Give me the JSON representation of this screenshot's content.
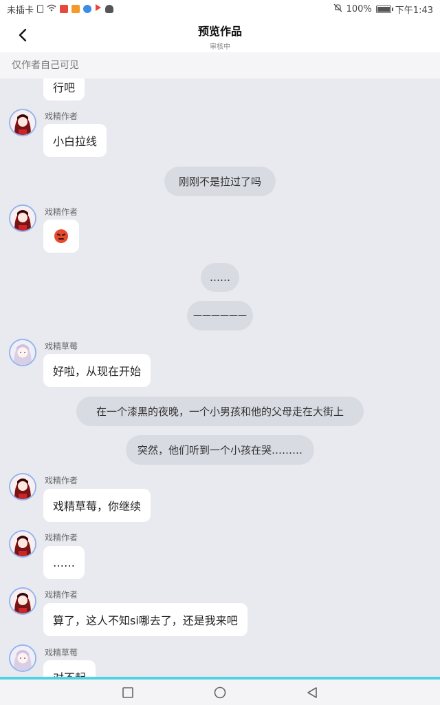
{
  "status": {
    "carrier": "未插卡",
    "battery": "100%",
    "time": "下午1:43"
  },
  "header": {
    "title": "预览作品",
    "subtitle": "审核中"
  },
  "notice": "仅作者自己可见",
  "messages": [
    {
      "type": "bubble",
      "text": "行吧"
    },
    {
      "type": "bubble",
      "sender": "戏精作者",
      "text": "小白拉线"
    },
    {
      "type": "narration",
      "text": "刚刚不是拉过了吗"
    },
    {
      "type": "bubble",
      "sender": "戏精作者",
      "text": "angry-face-emoji"
    },
    {
      "type": "narration",
      "text": "……"
    },
    {
      "type": "narration",
      "text": "——————"
    },
    {
      "type": "bubble",
      "sender": "戏精草莓",
      "text": "好啦，从现在开始"
    },
    {
      "type": "narration",
      "text": "在一个漆黑的夜晚，一个小男孩和他的父母走在大街上"
    },
    {
      "type": "narration",
      "text": "突然，他们听到一个小孩在哭………"
    },
    {
      "type": "bubble",
      "sender": "戏精作者",
      "text": "戏精草莓，你继续"
    },
    {
      "type": "bubble",
      "sender": "戏精作者",
      "text": "……"
    },
    {
      "type": "bubble",
      "sender": "戏精作者",
      "text": "算了，这人不知si哪去了，还是我来吧"
    },
    {
      "type": "bubble",
      "sender": "戏精草莓",
      "text": "对不起"
    }
  ],
  "colors": {
    "background": "#e9eaf0",
    "bubble": "#ffffff",
    "narration": "#d9dbe3",
    "avatar_border": "#8fb7ef",
    "nav_accent": "#4fd3e4"
  }
}
